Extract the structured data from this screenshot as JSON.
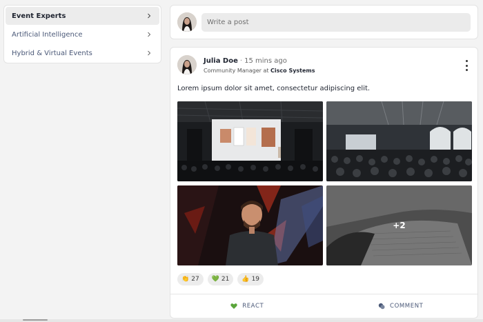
{
  "sidebar": {
    "items": [
      {
        "label": "Event Experts",
        "active": true
      },
      {
        "label": "Artificial Intelligence",
        "active": false
      },
      {
        "label": "Hybrid & Virtual Events",
        "active": false
      }
    ]
  },
  "composer": {
    "placeholder": "Write a post"
  },
  "post": {
    "author": "Julia Doe",
    "separator": "·",
    "time": "15 mins ago",
    "role_prefix": "Community Manager at",
    "company": "Cisco Systems",
    "text": "Lorem ipsum dolor sit amet, consectetur adipiscing elit.",
    "more_photos": "+2",
    "reactions": [
      {
        "icon": "clap-icon",
        "emoji": "👏",
        "count": "27"
      },
      {
        "icon": "green-heart-icon",
        "emoji": "💚",
        "count": "21"
      },
      {
        "icon": "thumbs-up-icon",
        "emoji": "👍",
        "count": "19"
      }
    ],
    "actions": {
      "react": "REACT",
      "comment": "COMMENT"
    }
  },
  "colors": {
    "accent_green": "#5aa53a",
    "muted_blue": "#4a5877",
    "active_bg": "#ececec"
  }
}
